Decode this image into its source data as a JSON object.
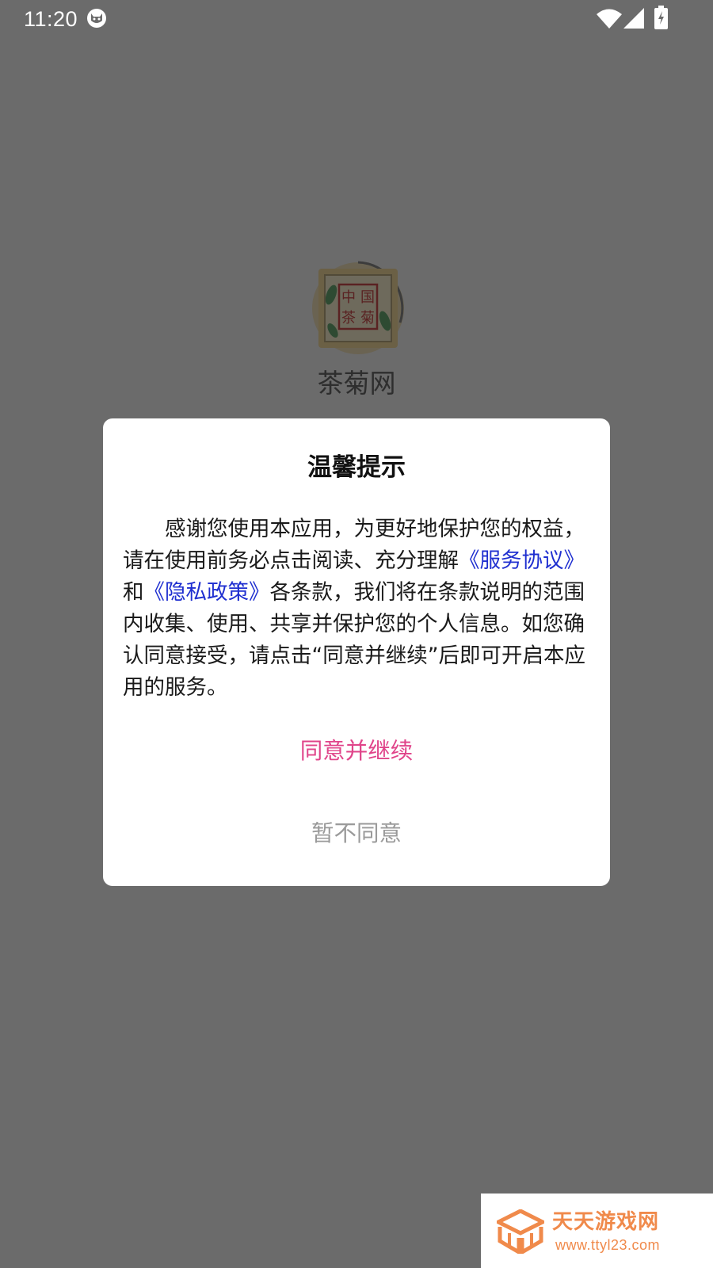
{
  "status_bar": {
    "time": "11:20",
    "icons": [
      "cat-notification-icon",
      "wifi-icon",
      "signal-icon",
      "battery-charging-icon"
    ]
  },
  "splash": {
    "logo_icon": "tea-seal-logo",
    "logo_text": [
      "中",
      "国",
      "茶",
      "菊"
    ],
    "app_name": "茶菊网"
  },
  "dialog": {
    "title": "温馨提示",
    "body": {
      "part1": "感谢您使用本应用，为更好地保护您的权益，请在使用前务必点击阅读、充分理解",
      "service_link": "《服务协议》",
      "part2": "和",
      "privacy_link": "《隐私政策》",
      "part3": "各条款，我们将在条款说明的范围内收集、使用、共享并保护您的个人信息。如您确认同意接受，请点击“同意并继续”后即可开启本应用的服务。"
    },
    "agree_label": "同意并继续",
    "disagree_label": "暂不同意"
  },
  "watermark": {
    "title": "天天游戏网",
    "url": "www.ttyl23.com"
  },
  "colors": {
    "overlay": "#6b6b6b",
    "link": "#1f2fd0",
    "agree": "#e0448a",
    "disagree": "#9a9a9a",
    "watermark": "#f08a4b"
  }
}
